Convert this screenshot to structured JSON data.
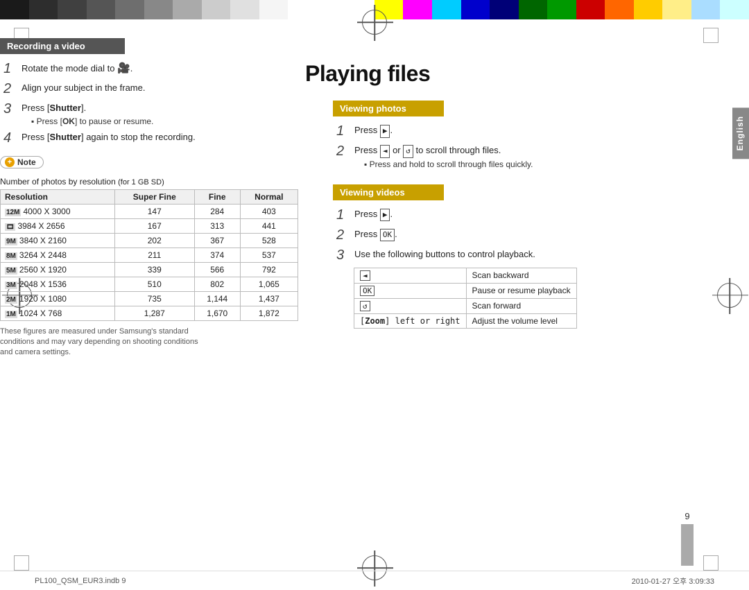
{
  "page": {
    "title": "Playing files",
    "page_number": "9",
    "bottom_left": "PL100_QSM_EUR3.indb   9",
    "bottom_right": "2010-01-27   오후 3:09:33"
  },
  "left_section": {
    "header": "Recording a video",
    "steps": [
      {
        "number": "1",
        "text": "Rotate the mode dial to "
      },
      {
        "number": "2",
        "text": "Align your subject in the frame."
      },
      {
        "number": "3",
        "text": "Press [Shutter].",
        "sub": "Press [OK] to pause or resume."
      },
      {
        "number": "4",
        "text": "Press [Shutter] again to stop the recording."
      }
    ],
    "note_label": "Note",
    "table_title": "Number of photos by resolution",
    "table_subtitle": "(for 1 GB SD)",
    "table_headers": [
      "Resolution",
      "Super Fine",
      "Fine",
      "Normal"
    ],
    "table_rows": [
      {
        "icon": "12M",
        "res": "4000 X 3000",
        "sf": "147",
        "f": "284",
        "n": "403"
      },
      {
        "icon": "10",
        "res": "3984 X 2656",
        "sf": "167",
        "f": "313",
        "n": "441"
      },
      {
        "icon": "9M",
        "res": "3840 X 2160",
        "sf": "202",
        "f": "367",
        "n": "528"
      },
      {
        "icon": "8M",
        "res": "3264 X 2448",
        "sf": "211",
        "f": "374",
        "n": "537"
      },
      {
        "icon": "5M",
        "res": "2560 X 1920",
        "sf": "339",
        "f": "566",
        "n": "792"
      },
      {
        "icon": "3M",
        "res": "2048 X 1536",
        "sf": "510",
        "f": "802",
        "n": "1,065"
      },
      {
        "icon": "2M",
        "res": "1920 X 1080",
        "sf": "735",
        "f": "1,144",
        "n": "1,437"
      },
      {
        "icon": "1M",
        "res": "1024 X 768",
        "sf": "1,287",
        "f": "1,670",
        "n": "1,872"
      }
    ],
    "footnote": "These figures are measured under Samsung's standard\nconditions and may vary depending on shooting conditions\nand camera settings."
  },
  "right_top_section": {
    "header": "Viewing photos",
    "steps": [
      {
        "number": "1",
        "text": "Press [▶]."
      },
      {
        "number": "2",
        "text": "Press [◄] or [↺] to scroll through files.",
        "sub": "Press and hold to scroll through files quickly."
      }
    ]
  },
  "right_bottom_section": {
    "header": "Viewing videos",
    "steps": [
      {
        "number": "1",
        "text": "Press [▶]."
      },
      {
        "number": "2",
        "text": "Press [OK]."
      },
      {
        "number": "3",
        "text": "Use the following buttons to control playback."
      }
    ],
    "control_rows": [
      {
        "btn": "[◄]",
        "desc": "Scan backward"
      },
      {
        "btn": "[OK]",
        "desc": "Pause or resume playback"
      },
      {
        "btn": "[↺]",
        "desc": "Scan forward"
      },
      {
        "btn": "[Zoom] left or right",
        "desc": "Adjust the volume level"
      }
    ]
  },
  "colors": {
    "swatches": [
      "#1a1a1a",
      "#2d2d2d",
      "#404040",
      "#555555",
      "#6e6e6e",
      "#888888",
      "#aaaaaa",
      "#cccccc",
      "#e5e5e5",
      "#ffffff",
      "#ffff00",
      "#ff00ff",
      "#00ffff",
      "#0000cc",
      "#000088",
      "#006600",
      "#009900",
      "#cc0000",
      "#ff6600",
      "#ffcc00",
      "#99ccff",
      "#ccffff"
    ]
  },
  "english_tab": "English"
}
